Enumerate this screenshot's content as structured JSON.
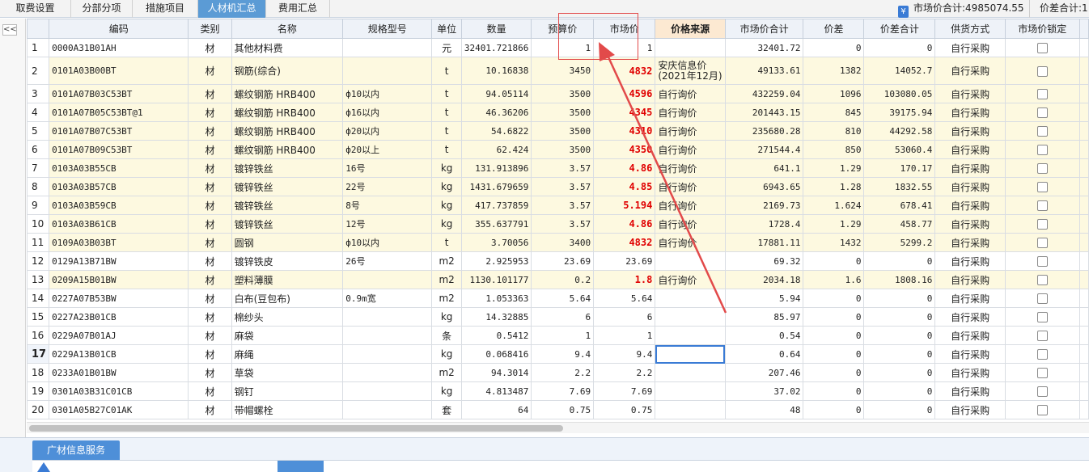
{
  "tabs": [
    {
      "label": "取费设置",
      "active": false
    },
    {
      "label": "分部分项",
      "active": false
    },
    {
      "label": "措施项目",
      "active": false
    },
    {
      "label": "人材机汇总",
      "active": true
    },
    {
      "label": "费用汇总",
      "active": false
    }
  ],
  "summary": {
    "market_total": "市场价合计:4985074.55",
    "diff_total": "价差合计:1"
  },
  "collapse_label": "<<",
  "columns": [
    "编码",
    "类别",
    "名称",
    "规格型号",
    "单位",
    "数量",
    "预算价",
    "市场价",
    "价格来源",
    "市场价合计",
    "价差",
    "价差合计",
    "供货方式",
    "市场价锁定"
  ],
  "rows": [
    {
      "idx": "1",
      "code": "0000A31B01AH",
      "cat": "材",
      "name": "其他材料费",
      "spec": "",
      "unit": "元",
      "qty": "32401.721866",
      "budget": "1",
      "market": "1",
      "market_red": false,
      "source": "",
      "market_total": "32401.72",
      "diff": "0",
      "diff_total": "0",
      "supply": "自行采购"
    },
    {
      "idx": "2",
      "code": "0101A03B00BT",
      "cat": "材",
      "name": "钢筋(综合)",
      "spec": "",
      "unit": "t",
      "qty": "10.16838",
      "budget": "3450",
      "market": "4832",
      "market_red": true,
      "source": "安庆信息价(2021年12月)",
      "market_total": "49133.61",
      "diff": "1382",
      "diff_total": "14052.7",
      "supply": "自行采购"
    },
    {
      "idx": "3",
      "code": "0101A07B03C53BT",
      "cat": "材",
      "name": "螺纹钢筋 HRB400",
      "spec": "ф10以内",
      "unit": "t",
      "qty": "94.05114",
      "budget": "3500",
      "market": "4596",
      "market_red": true,
      "source": "自行询价",
      "market_total": "432259.04",
      "diff": "1096",
      "diff_total": "103080.05",
      "supply": "自行采购"
    },
    {
      "idx": "4",
      "code": "0101A07B05C53BT@1",
      "cat": "材",
      "name": "螺纹钢筋 HRB400",
      "spec": "ф16以内",
      "unit": "t",
      "qty": "46.36206",
      "budget": "3500",
      "market": "4345",
      "market_red": true,
      "source": "自行询价",
      "market_total": "201443.15",
      "diff": "845",
      "diff_total": "39175.94",
      "supply": "自行采购"
    },
    {
      "idx": "5",
      "code": "0101A07B07C53BT",
      "cat": "材",
      "name": "螺纹钢筋 HRB400",
      "spec": "ф20以内",
      "unit": "t",
      "qty": "54.6822",
      "budget": "3500",
      "market": "4310",
      "market_red": true,
      "source": "自行询价",
      "market_total": "235680.28",
      "diff": "810",
      "diff_total": "44292.58",
      "supply": "自行采购"
    },
    {
      "idx": "6",
      "code": "0101A07B09C53BT",
      "cat": "材",
      "name": "螺纹钢筋 HRB400",
      "spec": "ф20以上",
      "unit": "t",
      "qty": "62.424",
      "budget": "3500",
      "market": "4350",
      "market_red": true,
      "source": "自行询价",
      "market_total": "271544.4",
      "diff": "850",
      "diff_total": "53060.4",
      "supply": "自行采购"
    },
    {
      "idx": "7",
      "code": "0103A03B55CB",
      "cat": "材",
      "name": "镀锌铁丝",
      "spec": "16号",
      "unit": "kg",
      "qty": "131.913896",
      "budget": "3.57",
      "market": "4.86",
      "market_red": true,
      "source": "自行询价",
      "market_total": "641.1",
      "diff": "1.29",
      "diff_total": "170.17",
      "supply": "自行采购"
    },
    {
      "idx": "8",
      "code": "0103A03B57CB",
      "cat": "材",
      "name": "镀锌铁丝",
      "spec": "22号",
      "unit": "kg",
      "qty": "1431.679659",
      "budget": "3.57",
      "market": "4.85",
      "market_red": true,
      "source": "自行询价",
      "market_total": "6943.65",
      "diff": "1.28",
      "diff_total": "1832.55",
      "supply": "自行采购"
    },
    {
      "idx": "9",
      "code": "0103A03B59CB",
      "cat": "材",
      "name": "镀锌铁丝",
      "spec": "8号",
      "unit": "kg",
      "qty": "417.737859",
      "budget": "3.57",
      "market": "5.194",
      "market_red": true,
      "source": "自行询价",
      "market_total": "2169.73",
      "diff": "1.624",
      "diff_total": "678.41",
      "supply": "自行采购"
    },
    {
      "idx": "10",
      "code": "0103A03B61CB",
      "cat": "材",
      "name": "镀锌铁丝",
      "spec": "12号",
      "unit": "kg",
      "qty": "355.637791",
      "budget": "3.57",
      "market": "4.86",
      "market_red": true,
      "source": "自行询价",
      "market_total": "1728.4",
      "diff": "1.29",
      "diff_total": "458.77",
      "supply": "自行采购"
    },
    {
      "idx": "11",
      "code": "0109A03B03BT",
      "cat": "材",
      "name": "圆钢",
      "spec": "ф10以内",
      "unit": "t",
      "qty": "3.70056",
      "budget": "3400",
      "market": "4832",
      "market_red": true,
      "source": "自行询价",
      "market_total": "17881.11",
      "diff": "1432",
      "diff_total": "5299.2",
      "supply": "自行采购"
    },
    {
      "idx": "12",
      "code": "0129A13B71BW",
      "cat": "材",
      "name": "镀锌铁皮",
      "spec": "26号",
      "unit": "m2",
      "qty": "2.925953",
      "budget": "23.69",
      "market": "23.69",
      "market_red": false,
      "source": "",
      "market_total": "69.32",
      "diff": "0",
      "diff_total": "0",
      "supply": "自行采购"
    },
    {
      "idx": "13",
      "code": "0209A15B01BW",
      "cat": "材",
      "name": "塑料薄膜",
      "spec": "",
      "unit": "m2",
      "qty": "1130.101177",
      "budget": "0.2",
      "market": "1.8",
      "market_red": true,
      "source": "自行询价",
      "market_total": "2034.18",
      "diff": "1.6",
      "diff_total": "1808.16",
      "supply": "自行采购"
    },
    {
      "idx": "14",
      "code": "0227A07B53BW",
      "cat": "材",
      "name": "白布(豆包布)",
      "spec": "0.9m宽",
      "unit": "m2",
      "qty": "1.053363",
      "budget": "5.64",
      "market": "5.64",
      "market_red": false,
      "source": "",
      "market_total": "5.94",
      "diff": "0",
      "diff_total": "0",
      "supply": "自行采购"
    },
    {
      "idx": "15",
      "code": "0227A23B01CB",
      "cat": "材",
      "name": "棉纱头",
      "spec": "",
      "unit": "kg",
      "qty": "14.32885",
      "budget": "6",
      "market": "6",
      "market_red": false,
      "source": "",
      "market_total": "85.97",
      "diff": "0",
      "diff_total": "0",
      "supply": "自行采购"
    },
    {
      "idx": "16",
      "code": "0229A07B01AJ",
      "cat": "材",
      "name": "麻袋",
      "spec": "",
      "unit": "条",
      "qty": "0.5412",
      "budget": "1",
      "market": "1",
      "market_red": false,
      "source": "",
      "market_total": "0.54",
      "diff": "0",
      "diff_total": "0",
      "supply": "自行采购"
    },
    {
      "idx": "17",
      "code": "0229A13B01CB",
      "cat": "材",
      "name": "麻绳",
      "spec": "",
      "unit": "kg",
      "qty": "0.068416",
      "budget": "9.4",
      "market": "9.4",
      "market_red": false,
      "source": "",
      "market_total": "0.64",
      "diff": "0",
      "diff_total": "0",
      "supply": "自行采购"
    },
    {
      "idx": "18",
      "code": "0233A01B01BW",
      "cat": "材",
      "name": "草袋",
      "spec": "",
      "unit": "m2",
      "qty": "94.3014",
      "budget": "2.2",
      "market": "2.2",
      "market_red": false,
      "source": "",
      "market_total": "207.46",
      "diff": "0",
      "diff_total": "0",
      "supply": "自行采购"
    },
    {
      "idx": "19",
      "code": "0301A03B31C01CB",
      "cat": "材",
      "name": "钢钉",
      "spec": "",
      "unit": "kg",
      "qty": "4.813487",
      "budget": "7.69",
      "market": "7.69",
      "market_red": false,
      "source": "",
      "market_total": "37.02",
      "diff": "0",
      "diff_total": "0",
      "supply": "自行采购"
    },
    {
      "idx": "20",
      "code": "0301A05B27C01AK",
      "cat": "材",
      "name": "带帽螺栓",
      "spec": "",
      "unit": "套",
      "qty": "64",
      "budget": "0.75",
      "market": "0.75",
      "market_red": false,
      "source": "",
      "market_total": "48",
      "diff": "0",
      "diff_total": "0",
      "supply": "自行采购"
    }
  ],
  "bottom": {
    "service_tab": "广材信息服务"
  },
  "colors": {
    "accent": "#5b9bd5",
    "price_red": "#e00000",
    "annotation": "#e24a4a",
    "highlight_row": "#fdf9e0"
  }
}
